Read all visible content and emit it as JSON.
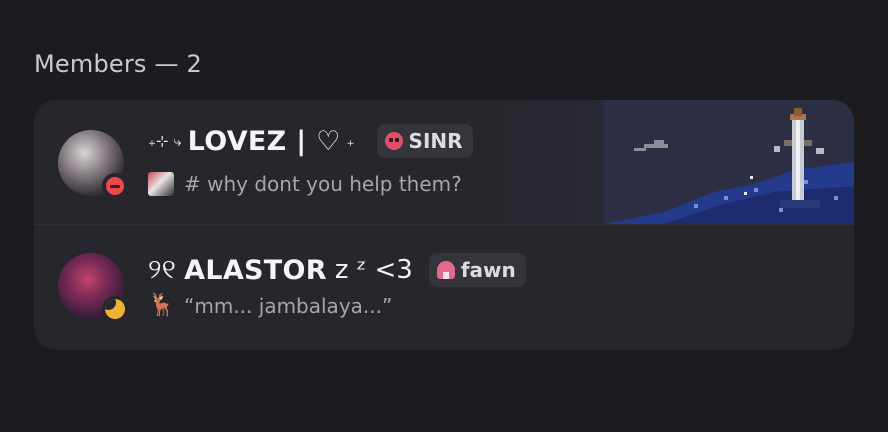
{
  "members_header": "Members — 2",
  "members": [
    {
      "name_prefix": "₊⊹ ⤷",
      "name": "LOVEZ | ♡",
      "name_suffix": "₊",
      "tag": "SINR",
      "tag_icon": "skull-icon",
      "status_text": "# why dont you help them?",
      "presence": "do-not-disturb",
      "presence_color": "#f04747"
    },
    {
      "name_prefix": "୨୧",
      "name": "ALASTOR",
      "name_suffix": "z ᶻ <3",
      "tag": "fawn",
      "tag_icon": "mushroom-icon",
      "status_text": "“mm... jambalaya...”",
      "status_emoji": "🦌",
      "presence": "idle",
      "presence_color": "#f0b232"
    }
  ]
}
